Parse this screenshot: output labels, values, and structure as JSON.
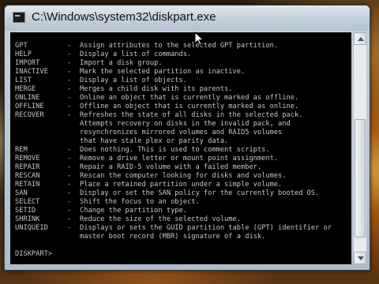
{
  "window": {
    "title": "C:\\Windows\\system32\\diskpart.exe",
    "app_icon": "console-icon"
  },
  "console": {
    "commands": [
      {
        "name": "GPT",
        "desc": [
          "Assign attributes to the selected GPT partition."
        ]
      },
      {
        "name": "HELP",
        "desc": [
          "Display a list of commands."
        ]
      },
      {
        "name": "IMPORT",
        "desc": [
          "Import a disk group."
        ]
      },
      {
        "name": "INACTIVE",
        "desc": [
          "Mark the selected partition as inactive."
        ]
      },
      {
        "name": "LIST",
        "desc": [
          "Display a list of objects."
        ]
      },
      {
        "name": "MERGE",
        "desc": [
          "Merges a child disk with its parents."
        ]
      },
      {
        "name": "ONLINE",
        "desc": [
          "Online an object that is currently marked as offline."
        ]
      },
      {
        "name": "OFFLINE",
        "desc": [
          "Offline an object that is currently marked as online."
        ]
      },
      {
        "name": "RECOVER",
        "desc": [
          "Refreshes the state of all disks in the selected pack.",
          "Attempts recovery on disks in the invalid pack, and",
          "resynchronizes mirrored volumes and RAID5 volumes",
          "that have stale plex or parity data."
        ]
      },
      {
        "name": "REM",
        "desc": [
          "Does nothing. This is used to comment scripts."
        ]
      },
      {
        "name": "REMOVE",
        "desc": [
          "Remove a drive letter or mount point assignment."
        ]
      },
      {
        "name": "REPAIR",
        "desc": [
          "Repair a RAID-5 volume with a failed member."
        ]
      },
      {
        "name": "RESCAN",
        "desc": [
          "Rescan the computer looking for disks and volumes."
        ]
      },
      {
        "name": "RETAIN",
        "desc": [
          "Place a retained partition under a simple volume."
        ]
      },
      {
        "name": "SAN",
        "desc": [
          "Display or set the SAN policy for the currently booted OS."
        ]
      },
      {
        "name": "SELECT",
        "desc": [
          "Shift the focus to an object."
        ]
      },
      {
        "name": "SETID",
        "desc": [
          "Change the partition type."
        ]
      },
      {
        "name": "SHRINK",
        "desc": [
          "Reduce the size of the selected volume."
        ]
      },
      {
        "name": "UNIQUEID",
        "desc": [
          "Displays or sets the GUID partition table (GPT) identifier or",
          "master boot record (MBR) signature of a disk."
        ]
      }
    ],
    "prompt": "DISKPART> "
  },
  "colors": {
    "console_bg": "#000000",
    "console_text": "#c6c6c6",
    "titlebar": "#c5d0db"
  }
}
